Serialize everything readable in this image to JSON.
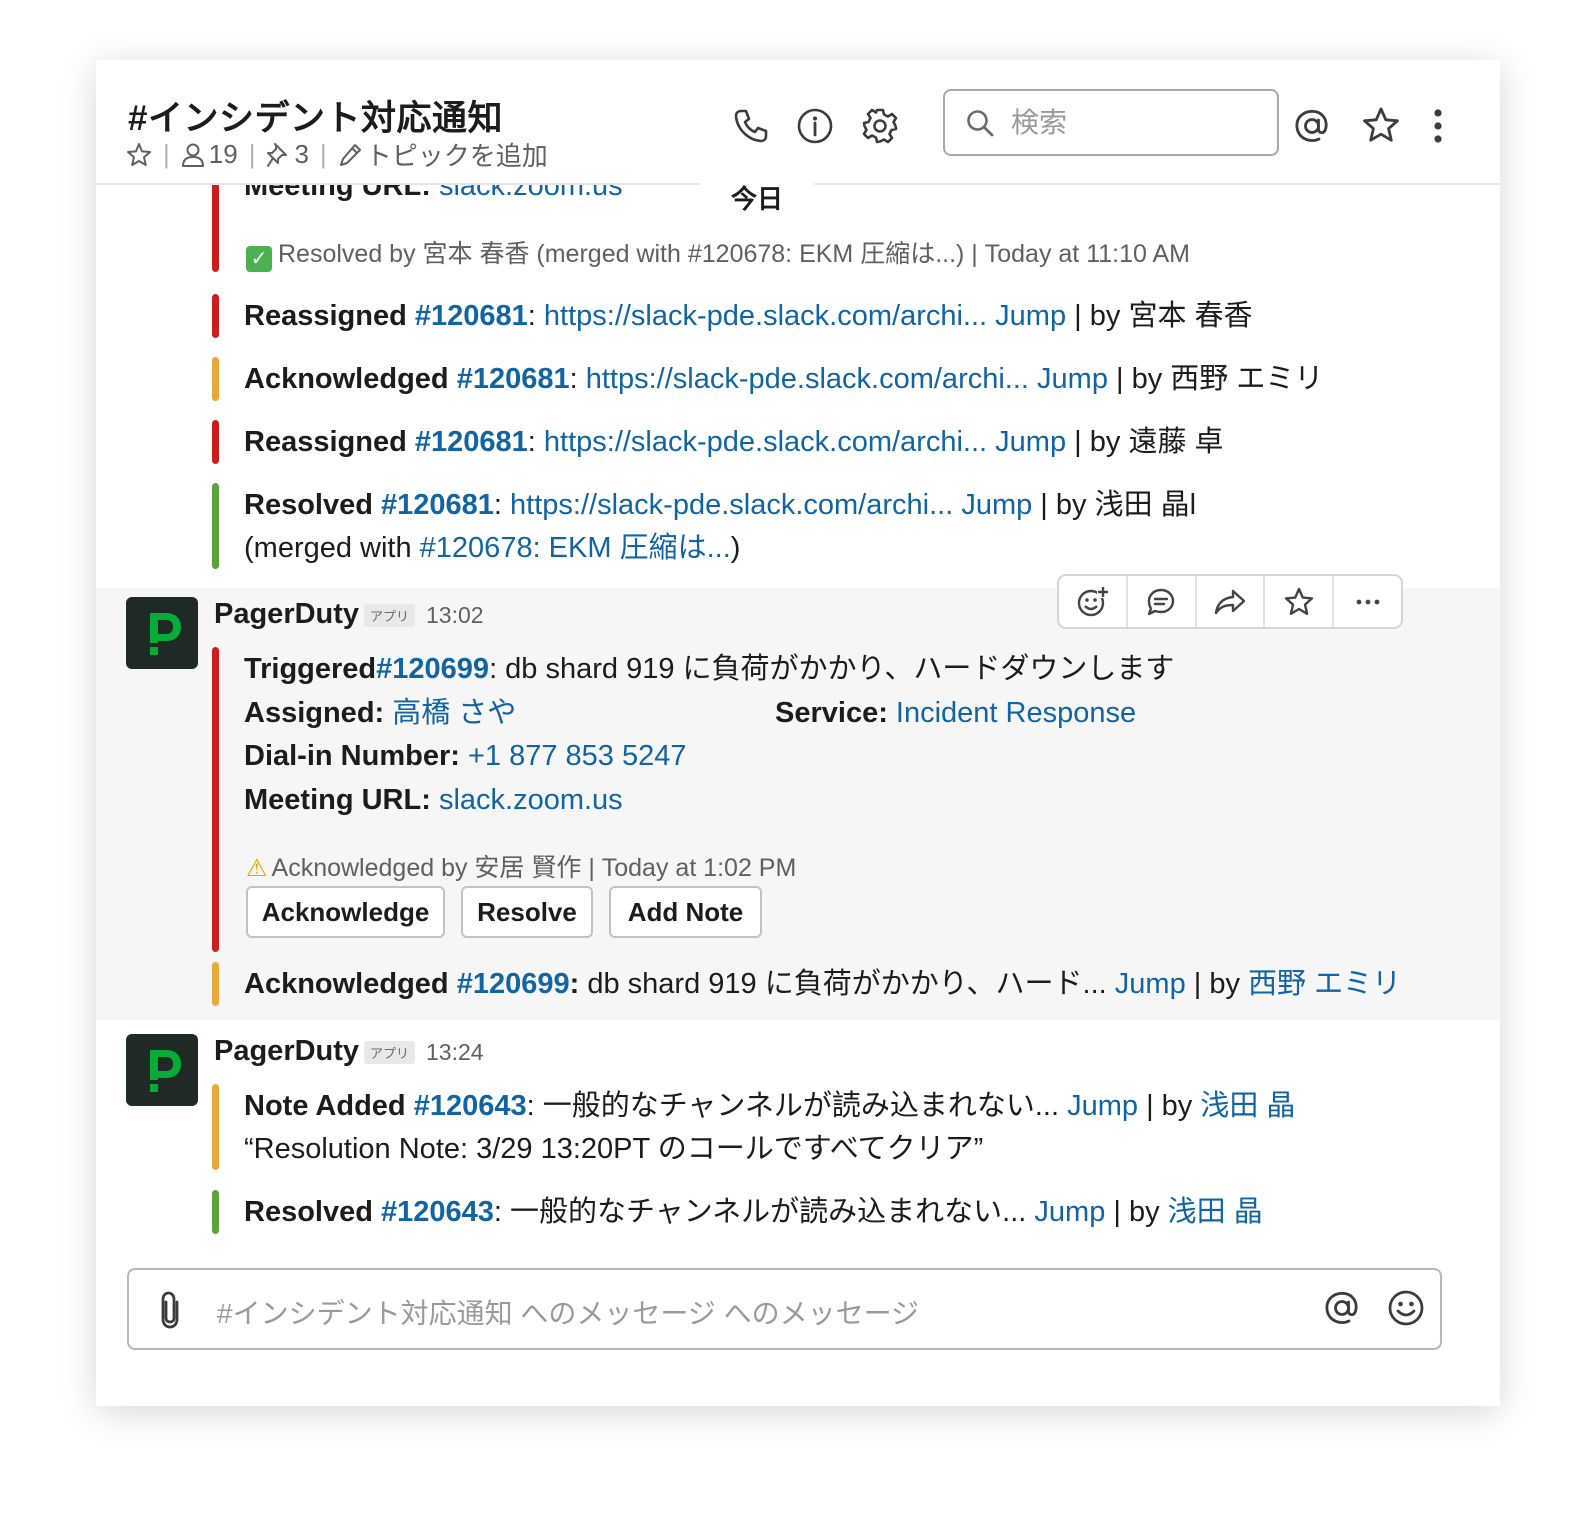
{
  "header": {
    "channel_name": "#インシデント対応通知",
    "members": "19",
    "pins": "3",
    "topic": "トピックを追加",
    "search_placeholder": "検索"
  },
  "divider": {
    "label": "今日"
  },
  "top_fragment": {
    "meeting_label": "Meeting URL:",
    "meeting_url": "slack.zoom.us",
    "resolved_note": "Resolved by 宮本 春香 (merged with #120678: EKM 圧縮は...) | Today at 11:10 AM"
  },
  "events_a": [
    {
      "action": "Reassigned",
      "incident": "#120681",
      "url": "https://slack-pde.slack.com/archi...",
      "jump": "Jump",
      "by_prefix": " | by ",
      "by": "宮本 春香",
      "color": "#cc1e1e"
    },
    {
      "action": "Acknowledged",
      "incident": "#120681",
      "url": "https://slack-pde.slack.com/archi...",
      "jump": "Jump",
      "by_prefix": " | by ",
      "by": "西野 エミリ",
      "color": "#e9a83a"
    },
    {
      "action": "Reassigned",
      "incident": "#120681",
      "url": "https://slack-pde.slack.com/archi...",
      "jump": "Jump",
      "by_prefix": " | by ",
      "by": "遠藤 卓",
      "color": "#cc1e1e"
    },
    {
      "action": "Resolved",
      "incident": "#120681",
      "url": "https://slack-pde.slack.com/archi...",
      "jump": "Jump",
      "by_prefix": " | by ",
      "by": "浅田 晶l",
      "merged_prefix": "(merged with ",
      "merged_link": "#120678: EKM 圧縮は...",
      "merged_suffix": ")",
      "color": "#58a53b"
    }
  ],
  "msg1": {
    "sender": "PagerDuty",
    "badge": "アプリ",
    "time": "13:02",
    "triggered": {
      "action": "Triggered",
      "incident": "#120699",
      "text": ": db shard 919 に負荷がかかり、ハードダウンします"
    },
    "assigned_label": "Assigned:",
    "assigned": "高橋 さや",
    "service_label": "Service:",
    "service": "Incident Response",
    "dial_label": "Dial-in Number:",
    "dial": "+1 877 853 5247",
    "meeting_label": "Meeting URL:",
    "meeting_url": "slack.zoom.us",
    "ack_note": "Acknowledged by 安居 賢作 | Today at 1:02 PM",
    "buttons": [
      "Acknowledge",
      "Resolve",
      "Add Note"
    ],
    "ack_event": {
      "action": "Acknowledged",
      "incident": "#120699",
      "colon": ":",
      "text": " db shard 919 に負荷がかかり、ハード... ",
      "jump": "Jump",
      "by_prefix": " | by ",
      "by": "西野 エミリ"
    }
  },
  "msg2": {
    "sender": "PagerDuty",
    "badge": "アプリ",
    "time": "13:24",
    "note": {
      "action": "Note Added",
      "incident": "#120643",
      "text": ": 一般的なチャンネルが読み込まれない... ",
      "jump": "Jump",
      "by_prefix": " | by ",
      "by": "浅田 晶",
      "quote": "“Resolution Note: 3/29 13:20PT のコールですべてクリア”"
    },
    "resolved": {
      "action": "Resolved",
      "incident": "#120643",
      "text": ": 一般的なチャンネルが読み込まれない... ",
      "jump": "Jump",
      "by_prefix": " | by ",
      "by": "浅田 晶"
    }
  },
  "composer": {
    "placeholder": "#インシデント対応通知 へのメッセージ へのメッセージ"
  },
  "colors": {
    "link": "#1264a3",
    "red": "#cc1e1e",
    "yellow": "#e9a83a",
    "green": "#58a53b",
    "pd_green": "#06ac38"
  }
}
